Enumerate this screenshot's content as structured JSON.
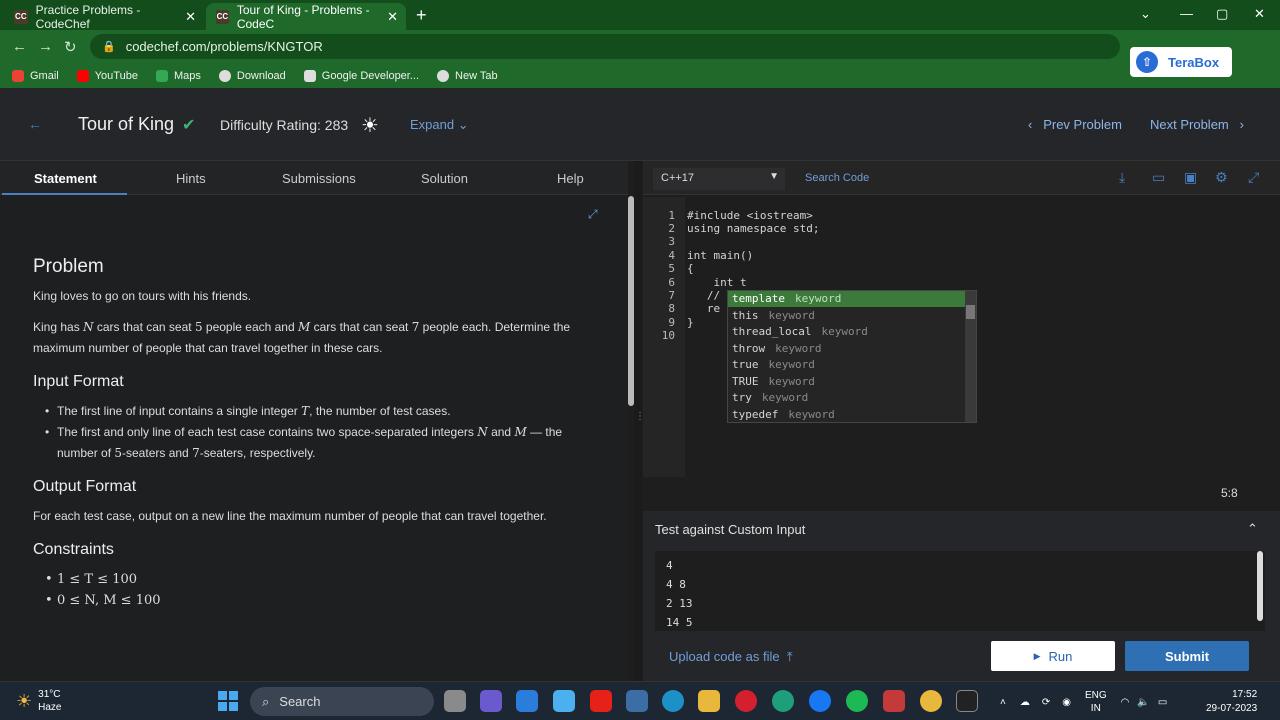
{
  "browser": {
    "tabs": [
      {
        "title": "Practice Problems - CodeChef",
        "favicon": "CC"
      },
      {
        "title": "Tour of King - Problems - CodeC",
        "favicon": "CC"
      }
    ],
    "url": "codechef.com/problems/KNGTOR",
    "extension_label": "TeraBox",
    "bookmarks": [
      "Gmail",
      "YouTube",
      "Maps",
      "Download",
      "Google Developer...",
      "New Tab"
    ]
  },
  "header": {
    "title": "Tour of King",
    "difficulty": "Difficulty Rating: 283",
    "expand_label": "Expand",
    "prev_label": "Prev Problem",
    "next_label": "Next Problem"
  },
  "problem_tabs": [
    "Statement",
    "Hints",
    "Submissions",
    "Solution",
    "Help"
  ],
  "statement": {
    "problem_heading": "Problem",
    "intro": "King loves to go on tours with his friends.",
    "body_parts": [
      "King has ",
      "N",
      " cars that can seat ",
      "5",
      " people each and ",
      "M",
      " cars that can seat ",
      "7",
      " people each. Determine the maximum number of people that can travel together in these cars."
    ],
    "input_heading": "Input Format",
    "input_items": [
      [
        "The first line of input contains a single integer ",
        "T",
        ", the number of test cases."
      ],
      [
        "The first and only line of each test case contains two space-separated integers ",
        "N",
        " and ",
        "M",
        " — the number of ",
        "5",
        "-seaters and ",
        "7",
        "-seaters, respectively."
      ]
    ],
    "output_heading": "Output Format",
    "output_text": "For each test case, output on a new line the maximum number of people that can travel together.",
    "constraints_heading": "Constraints",
    "constraints": [
      "1 ≤ T ≤ 100",
      "0 ≤ N, M ≤ 100"
    ]
  },
  "editor": {
    "language": "C++17",
    "search_placeholder": "Search Code",
    "lines": [
      "#include <iostream>",
      "using namespace std;",
      "",
      "int main()",
      "{",
      "    int t",
      "   //",
      "   re",
      "}",
      ""
    ],
    "autocomplete": [
      {
        "word": "template",
        "type": "keyword"
      },
      {
        "word": "this",
        "type": "keyword"
      },
      {
        "word": "thread_local",
        "type": "keyword"
      },
      {
        "word": "throw",
        "type": "keyword"
      },
      {
        "word": "true",
        "type": "keyword"
      },
      {
        "word": "TRUE",
        "type": "keyword"
      },
      {
        "word": "try",
        "type": "keyword"
      },
      {
        "word": "typedef",
        "type": "keyword"
      }
    ],
    "cursor_position": "5:8"
  },
  "custom_input": {
    "title": "Test against Custom Input",
    "lines": [
      "4",
      "4 8",
      "2 13",
      "14 5"
    ],
    "upload_label": "Upload code as file",
    "run_label": "Run",
    "submit_label": "Submit"
  },
  "taskbar": {
    "temperature": "31°C",
    "weather": "Haze",
    "search_label": "Search",
    "lang_top": "ENG",
    "lang_bottom": "IN",
    "time": "17:52",
    "date": "29-07-2023"
  }
}
